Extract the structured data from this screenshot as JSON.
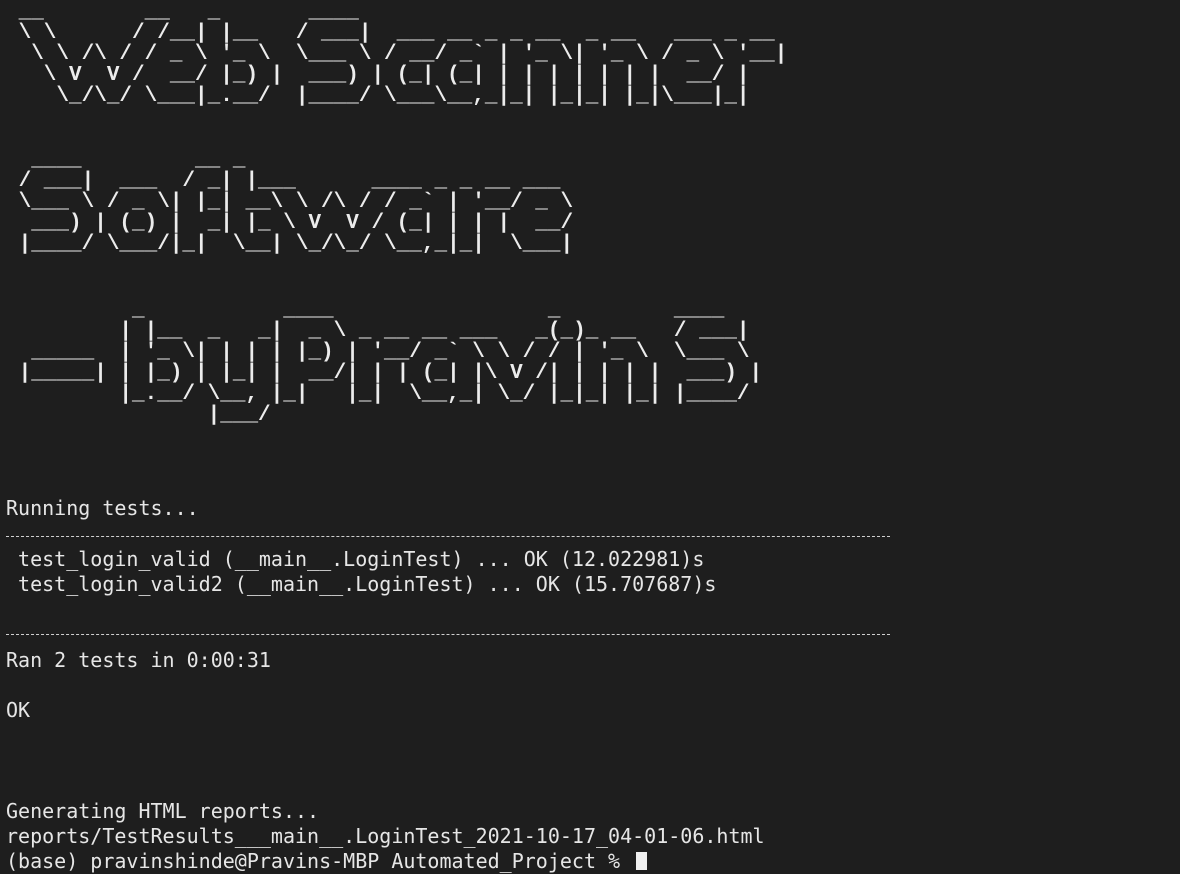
{
  "banner": {
    "line1": "Web Scanner",
    "line2": "Software",
    "line3": "-by Pravin S"
  },
  "output": {
    "running": "Running tests...",
    "tests": [
      " test_login_valid (__main__.LoginTest) ... OK (12.022981)s",
      " test_login_valid2 (__main__.LoginTest) ... OK (15.707687)s"
    ],
    "summary": "Ran 2 tests in 0:00:31",
    "status": "OK",
    "generating": "Generating HTML reports...",
    "report_path": "reports/TestResults___main__.LoginTest_2021-10-17_04-01-06.html",
    "prompt": "(base) pravinshinde@Pravins-MBP Automated_Project % "
  },
  "colors": {
    "background": "#1e1e1e",
    "text": "#e6e6e6"
  }
}
